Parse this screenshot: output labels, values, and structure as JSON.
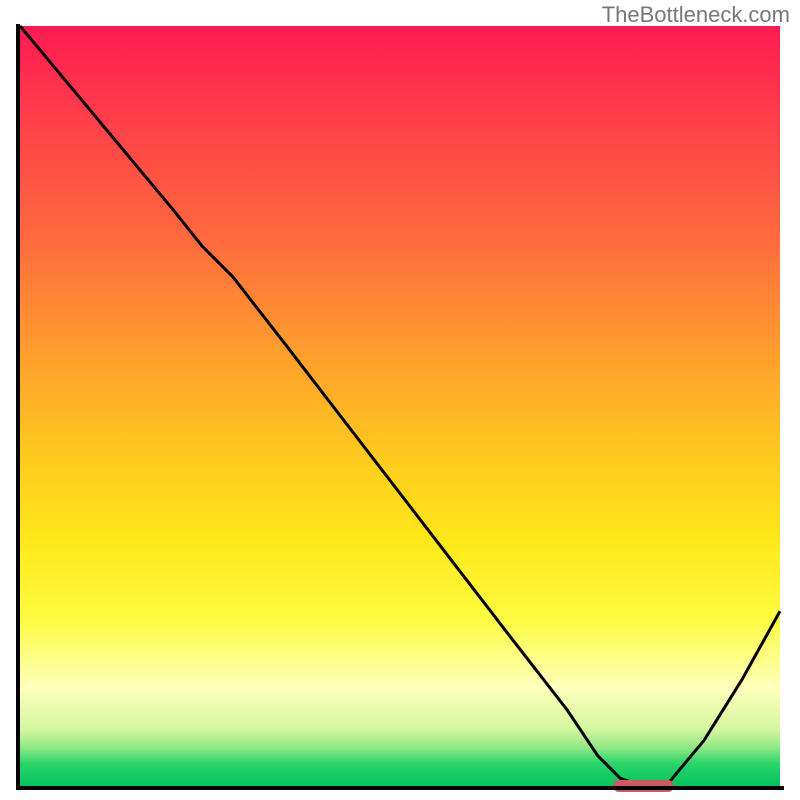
{
  "watermark": "TheBottleneck.com",
  "chart_data": {
    "type": "line",
    "title": "",
    "xlabel": "",
    "ylabel": "",
    "xlim": [
      0,
      100
    ],
    "ylim": [
      0,
      100
    ],
    "x": [
      0,
      5,
      10,
      15,
      20,
      24,
      28,
      35,
      45,
      55,
      65,
      72,
      76,
      79,
      82,
      85,
      90,
      95,
      100
    ],
    "values": [
      100,
      94,
      88,
      82,
      76,
      71,
      67,
      58,
      45,
      32,
      19,
      10,
      4,
      1,
      0,
      0,
      6,
      14,
      23
    ],
    "minimum_band": {
      "x_start": 78,
      "x_end": 86,
      "y": 0
    },
    "gradient_colors": {
      "top": "#ff1a52",
      "mid1": "#ff9a2e",
      "mid2": "#ffe81a",
      "bottom": "#05c45d"
    },
    "marker_color": "#cd5a5e",
    "curve_color": "#000000"
  }
}
